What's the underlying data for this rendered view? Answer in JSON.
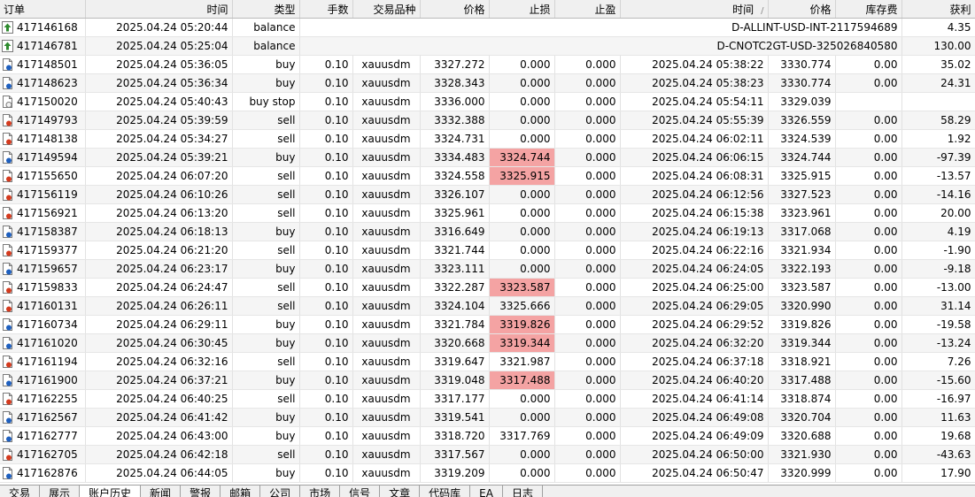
{
  "headers": [
    "订单",
    "时间",
    "类型",
    "手数",
    "交易品种",
    "价格",
    "止损",
    "止盈",
    "时间",
    "价格",
    "库存费",
    "获利"
  ],
  "sort_indicator": "/",
  "balance_rows": [
    {
      "ticket": "417146168",
      "time": "2025.04.24 05:20:44",
      "type": "balance",
      "comment": "D-ALLINT-USD-INT-2117594689",
      "profit": "4.35"
    },
    {
      "ticket": "417146781",
      "time": "2025.04.24 05:25:04",
      "type": "balance",
      "comment": "D-CNOTC2GT-USD-325026840580",
      "profit": "130.00"
    }
  ],
  "trade_rows": [
    {
      "ticket": "417148501",
      "time": "2025.04.24 05:36:05",
      "type": "buy",
      "volume": "0.10",
      "symbol": "xauusdm",
      "price": "3327.272",
      "sl": "0.000",
      "sl_hl": false,
      "tp": "0.000",
      "close_time": "2025.04.24 05:38:22",
      "close_price": "3330.774",
      "swap": "0.00",
      "profit": "35.02",
      "icon": "buy"
    },
    {
      "ticket": "417148623",
      "time": "2025.04.24 05:36:34",
      "type": "buy",
      "volume": "0.10",
      "symbol": "xauusdm",
      "price": "3328.343",
      "sl": "0.000",
      "sl_hl": false,
      "tp": "0.000",
      "close_time": "2025.04.24 05:38:23",
      "close_price": "3330.774",
      "swap": "0.00",
      "profit": "24.31",
      "icon": "buy"
    },
    {
      "ticket": "417150020",
      "time": "2025.04.24 05:40:43",
      "type": "buy stop",
      "volume": "0.10",
      "symbol": "xauusdm",
      "price": "3336.000",
      "sl": "0.000",
      "sl_hl": false,
      "tp": "0.000",
      "close_time": "2025.04.24 05:54:11",
      "close_price": "3329.039",
      "swap": "",
      "profit": "",
      "icon": "pending"
    },
    {
      "ticket": "417149793",
      "time": "2025.04.24 05:39:59",
      "type": "sell",
      "volume": "0.10",
      "symbol": "xauusdm",
      "price": "3332.388",
      "sl": "0.000",
      "sl_hl": false,
      "tp": "0.000",
      "close_time": "2025.04.24 05:55:39",
      "close_price": "3326.559",
      "swap": "0.00",
      "profit": "58.29",
      "icon": "sell"
    },
    {
      "ticket": "417148138",
      "time": "2025.04.24 05:34:27",
      "type": "sell",
      "volume": "0.10",
      "symbol": "xauusdm",
      "price": "3324.731",
      "sl": "0.000",
      "sl_hl": false,
      "tp": "0.000",
      "close_time": "2025.04.24 06:02:11",
      "close_price": "3324.539",
      "swap": "0.00",
      "profit": "1.92",
      "icon": "sell"
    },
    {
      "ticket": "417149594",
      "time": "2025.04.24 05:39:21",
      "type": "buy",
      "volume": "0.10",
      "symbol": "xauusdm",
      "price": "3334.483",
      "sl": "3324.744",
      "sl_hl": true,
      "tp": "0.000",
      "close_time": "2025.04.24 06:06:15",
      "close_price": "3324.744",
      "swap": "0.00",
      "profit": "-97.39",
      "icon": "buy"
    },
    {
      "ticket": "417155650",
      "time": "2025.04.24 06:07:20",
      "type": "sell",
      "volume": "0.10",
      "symbol": "xauusdm",
      "price": "3324.558",
      "sl": "3325.915",
      "sl_hl": true,
      "tp": "0.000",
      "close_time": "2025.04.24 06:08:31",
      "close_price": "3325.915",
      "swap": "0.00",
      "profit": "-13.57",
      "icon": "sell"
    },
    {
      "ticket": "417156119",
      "time": "2025.04.24 06:10:26",
      "type": "sell",
      "volume": "0.10",
      "symbol": "xauusdm",
      "price": "3326.107",
      "sl": "0.000",
      "sl_hl": false,
      "tp": "0.000",
      "close_time": "2025.04.24 06:12:56",
      "close_price": "3327.523",
      "swap": "0.00",
      "profit": "-14.16",
      "icon": "sell"
    },
    {
      "ticket": "417156921",
      "time": "2025.04.24 06:13:20",
      "type": "sell",
      "volume": "0.10",
      "symbol": "xauusdm",
      "price": "3325.961",
      "sl": "0.000",
      "sl_hl": false,
      "tp": "0.000",
      "close_time": "2025.04.24 06:15:38",
      "close_price": "3323.961",
      "swap": "0.00",
      "profit": "20.00",
      "icon": "sell"
    },
    {
      "ticket": "417158387",
      "time": "2025.04.24 06:18:13",
      "type": "buy",
      "volume": "0.10",
      "symbol": "xauusdm",
      "price": "3316.649",
      "sl": "0.000",
      "sl_hl": false,
      "tp": "0.000",
      "close_time": "2025.04.24 06:19:13",
      "close_price": "3317.068",
      "swap": "0.00",
      "profit": "4.19",
      "icon": "buy"
    },
    {
      "ticket": "417159377",
      "time": "2025.04.24 06:21:20",
      "type": "sell",
      "volume": "0.10",
      "symbol": "xauusdm",
      "price": "3321.744",
      "sl": "0.000",
      "sl_hl": false,
      "tp": "0.000",
      "close_time": "2025.04.24 06:22:16",
      "close_price": "3321.934",
      "swap": "0.00",
      "profit": "-1.90",
      "icon": "sell"
    },
    {
      "ticket": "417159657",
      "time": "2025.04.24 06:23:17",
      "type": "buy",
      "volume": "0.10",
      "symbol": "xauusdm",
      "price": "3323.111",
      "sl": "0.000",
      "sl_hl": false,
      "tp": "0.000",
      "close_time": "2025.04.24 06:24:05",
      "close_price": "3322.193",
      "swap": "0.00",
      "profit": "-9.18",
      "icon": "buy"
    },
    {
      "ticket": "417159833",
      "time": "2025.04.24 06:24:47",
      "type": "sell",
      "volume": "0.10",
      "symbol": "xauusdm",
      "price": "3322.287",
      "sl": "3323.587",
      "sl_hl": true,
      "tp": "0.000",
      "close_time": "2025.04.24 06:25:00",
      "close_price": "3323.587",
      "swap": "0.00",
      "profit": "-13.00",
      "icon": "sell"
    },
    {
      "ticket": "417160131",
      "time": "2025.04.24 06:26:11",
      "type": "sell",
      "volume": "0.10",
      "symbol": "xauusdm",
      "price": "3324.104",
      "sl": "3325.666",
      "sl_hl": false,
      "tp": "0.000",
      "close_time": "2025.04.24 06:29:05",
      "close_price": "3320.990",
      "swap": "0.00",
      "profit": "31.14",
      "icon": "sell"
    },
    {
      "ticket": "417160734",
      "time": "2025.04.24 06:29:11",
      "type": "buy",
      "volume": "0.10",
      "symbol": "xauusdm",
      "price": "3321.784",
      "sl": "3319.826",
      "sl_hl": true,
      "tp": "0.000",
      "close_time": "2025.04.24 06:29:52",
      "close_price": "3319.826",
      "swap": "0.00",
      "profit": "-19.58",
      "icon": "buy"
    },
    {
      "ticket": "417161020",
      "time": "2025.04.24 06:30:45",
      "type": "buy",
      "volume": "0.10",
      "symbol": "xauusdm",
      "price": "3320.668",
      "sl": "3319.344",
      "sl_hl": true,
      "tp": "0.000",
      "close_time": "2025.04.24 06:32:20",
      "close_price": "3319.344",
      "swap": "0.00",
      "profit": "-13.24",
      "icon": "buy"
    },
    {
      "ticket": "417161194",
      "time": "2025.04.24 06:32:16",
      "type": "sell",
      "volume": "0.10",
      "symbol": "xauusdm",
      "price": "3319.647",
      "sl": "3321.987",
      "sl_hl": false,
      "tp": "0.000",
      "close_time": "2025.04.24 06:37:18",
      "close_price": "3318.921",
      "swap": "0.00",
      "profit": "7.26",
      "icon": "sell"
    },
    {
      "ticket": "417161900",
      "time": "2025.04.24 06:37:21",
      "type": "buy",
      "volume": "0.10",
      "symbol": "xauusdm",
      "price": "3319.048",
      "sl": "3317.488",
      "sl_hl": true,
      "tp": "0.000",
      "close_time": "2025.04.24 06:40:20",
      "close_price": "3317.488",
      "swap": "0.00",
      "profit": "-15.60",
      "icon": "buy"
    },
    {
      "ticket": "417162255",
      "time": "2025.04.24 06:40:25",
      "type": "sell",
      "volume": "0.10",
      "symbol": "xauusdm",
      "price": "3317.177",
      "sl": "0.000",
      "sl_hl": false,
      "tp": "0.000",
      "close_time": "2025.04.24 06:41:14",
      "close_price": "3318.874",
      "swap": "0.00",
      "profit": "-16.97",
      "icon": "sell"
    },
    {
      "ticket": "417162567",
      "time": "2025.04.24 06:41:42",
      "type": "buy",
      "volume": "0.10",
      "symbol": "xauusdm",
      "price": "3319.541",
      "sl": "0.000",
      "sl_hl": false,
      "tp": "0.000",
      "close_time": "2025.04.24 06:49:08",
      "close_price": "3320.704",
      "swap": "0.00",
      "profit": "11.63",
      "icon": "buy"
    },
    {
      "ticket": "417162777",
      "time": "2025.04.24 06:43:00",
      "type": "buy",
      "volume": "0.10",
      "symbol": "xauusdm",
      "price": "3318.720",
      "sl": "3317.769",
      "sl_hl": false,
      "tp": "0.000",
      "close_time": "2025.04.24 06:49:09",
      "close_price": "3320.688",
      "swap": "0.00",
      "profit": "19.68",
      "icon": "buy"
    },
    {
      "ticket": "417162705",
      "time": "2025.04.24 06:42:18",
      "type": "sell",
      "volume": "0.10",
      "symbol": "xauusdm",
      "price": "3317.567",
      "sl": "0.000",
      "sl_hl": false,
      "tp": "0.000",
      "close_time": "2025.04.24 06:50:00",
      "close_price": "3321.930",
      "swap": "0.00",
      "profit": "-43.63",
      "icon": "sell"
    },
    {
      "ticket": "417162876",
      "time": "2025.04.24 06:44:05",
      "type": "buy",
      "volume": "0.10",
      "symbol": "xauusdm",
      "price": "3319.209",
      "sl": "0.000",
      "sl_hl": false,
      "tp": "0.000",
      "close_time": "2025.04.24 06:50:47",
      "close_price": "3320.999",
      "swap": "0.00",
      "profit": "17.90",
      "icon": "buy"
    }
  ],
  "tabs": [
    {
      "label": "交易",
      "active": false
    },
    {
      "label": "展示",
      "active": false
    },
    {
      "label": "账户历史",
      "active": true
    },
    {
      "label": "新闻",
      "active": false
    },
    {
      "label": "警报",
      "active": false
    },
    {
      "label": "邮箱",
      "active": false
    },
    {
      "label": "公司",
      "active": false
    },
    {
      "label": "市场",
      "active": false
    },
    {
      "label": "信号",
      "active": false
    },
    {
      "label": "文章",
      "active": false
    },
    {
      "label": "代码库",
      "active": false
    },
    {
      "label": "EA",
      "active": false
    },
    {
      "label": "日志",
      "active": false
    }
  ],
  "colors": {
    "highlight": "#f4a3a3",
    "balance_icon": "#2e8b2e",
    "buy_icon": "#1e5fbf",
    "sell_icon": "#d43a1e"
  }
}
